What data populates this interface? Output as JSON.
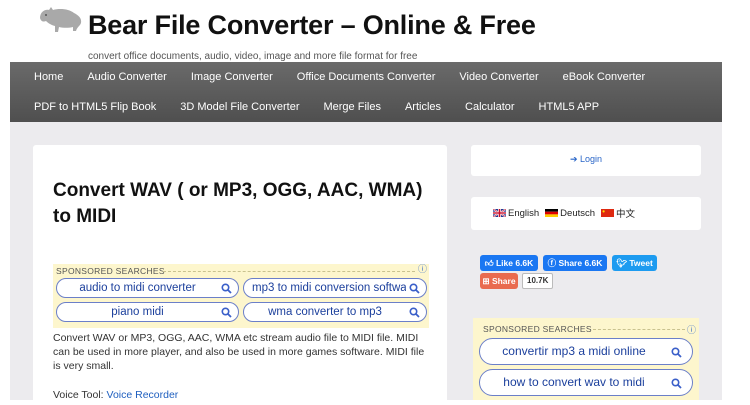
{
  "site": {
    "title": "Bear File Converter – Online & Free",
    "tagline": "convert office documents, audio, video, image and more file format for free"
  },
  "nav": {
    "row1": [
      "Home",
      "Audio Converter",
      "Image Converter",
      "Office Documents Converter",
      "Video Converter",
      "eBook Converter"
    ],
    "row2": [
      "PDF to HTML5 Flip Book",
      "3D Model File Converter",
      "Merge Files",
      "Articles",
      "Calculator",
      "HTML5 APP"
    ]
  },
  "main": {
    "title": "Convert WAV ( or MP3, OGG, AAC, WMA) to MIDI",
    "sponsored_label": "SPONSORED SEARCHES",
    "sponsored_pills": [
      "audio to midi converter",
      "mp3 to midi conversion softwa",
      "piano midi",
      "wma converter to mp3"
    ],
    "body": "Convert WAV or MP3, OGG, AAC, WMA etc stream audio file to MIDI file. MIDI can be used in more player, and also be used in more games software. MIDI file is very small.",
    "voice_tool_label": "Voice Tool:",
    "voice_tool_link": "Voice Recorder"
  },
  "sidebar": {
    "login": "Login",
    "languages": [
      "English",
      "Deutsch",
      "中文"
    ],
    "fb_like": "Like 6.6K",
    "fb_share": "Share 6.6K",
    "tweet": "Tweet",
    "share": "Share",
    "share_count": "10.7K",
    "sponsored_label": "SPONSORED SEARCHES",
    "sponsored_pills": [
      "convertir mp3 a midi online",
      "how to convert wav to midi"
    ]
  },
  "colors": {
    "nav_bg": "#5a5a5a",
    "sponsored_bg": "#fdf6cd",
    "link": "#1f5fbf",
    "facebook": "#1a77f2",
    "twitter": "#1d9bf0",
    "share": "#e96b4f"
  }
}
